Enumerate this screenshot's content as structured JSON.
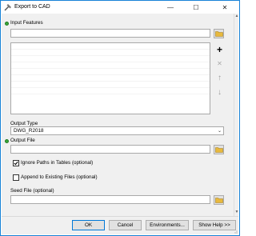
{
  "window": {
    "title": "Export to CAD",
    "minimize": "—",
    "maximize": "☐",
    "close": "✕"
  },
  "form": {
    "input_features": {
      "label": "Input Features",
      "value": "",
      "rows": 8
    },
    "output_type": {
      "label": "Output Type",
      "value": "DWG_R2018"
    },
    "output_file": {
      "label": "Output File",
      "value": ""
    },
    "ignore_paths": {
      "label": "Ignore Paths in Tables (optional)",
      "checked": true
    },
    "append_existing": {
      "label": "Append to Existing Files (optional)",
      "checked": false
    },
    "seed_file": {
      "label": "Seed File (optional)",
      "value": ""
    }
  },
  "list_buttons": {
    "add": "+",
    "remove": "✕",
    "up": "↑",
    "down": "↓"
  },
  "buttons": {
    "ok": "OK",
    "cancel": "Cancel",
    "environments": "Environments...",
    "show_help": "Show Help >>"
  },
  "colors": {
    "accent": "#0078d7",
    "required_dot": "#3aa63a",
    "folder": "#e8b93d"
  }
}
